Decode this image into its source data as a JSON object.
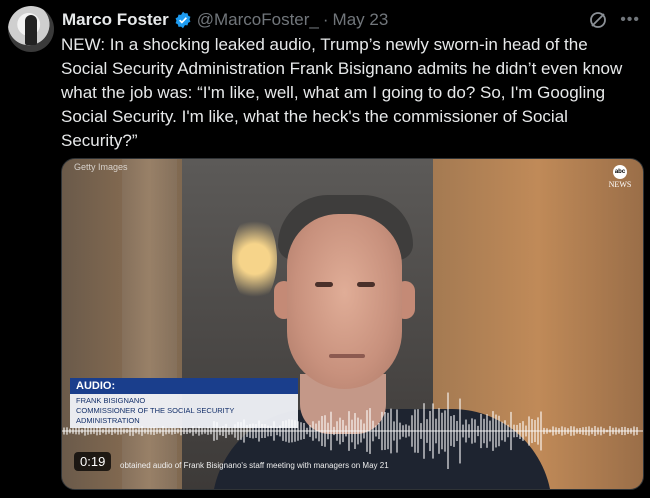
{
  "author": {
    "name": "Marco Foster",
    "handle": "@MarcoFoster_",
    "separator": "·",
    "date": "May 23"
  },
  "tweet": {
    "text": "NEW: In a shocking leaked audio, Trump’s newly sworn-in head of the Social Security Administration Frank Bisignano admits he didn’t even know what the job was: “I'm like, well, what am I going to do? So, I'm Googling Social Security. I'm like, what the heck's the commissioner of Social Security?”"
  },
  "media": {
    "credit": "Getty Images",
    "network_logo": "abc",
    "network_name": "NEWS",
    "lower_third": {
      "title": "AUDIO:",
      "name": "FRANK BISIGNANO",
      "role": "COMMISSIONER OF THE SOCIAL SECURITY ADMINISTRATION"
    },
    "timestamp": "0:19",
    "caption": "obtained audio of Frank Bisignano's staff meeting with managers on May 21"
  },
  "icons": {
    "verified": "verified-badge-icon",
    "grok": "grok-icon",
    "more": "more-icon"
  },
  "colors": {
    "verified": "#1d9bf0",
    "lower_third_bar": "#1a3e8c",
    "secondary_text": "#71767b"
  }
}
